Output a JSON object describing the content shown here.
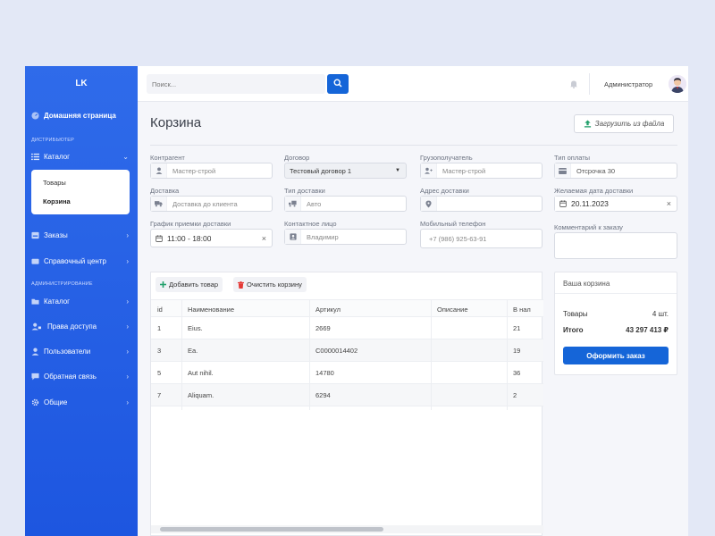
{
  "sidebar": {
    "logo": "LK",
    "home": "Домашняя страница",
    "section_distributor": "ДИСТРИБЬЮТЕР",
    "catalog": "Каталог",
    "submenu": [
      "Товары",
      "Корзина"
    ],
    "orders": "Заказы",
    "help": "Справочный центр",
    "section_admin": "АДМИНИСТРИРОВАНИЕ",
    "admin_catalog": "Каталог",
    "access": "Права доступа",
    "users": "Пользователи",
    "feedback": "Обратная связь",
    "general": "Общие"
  },
  "topbar": {
    "search_placeholder": "Поиск...",
    "user_name": "Администратор"
  },
  "page": {
    "title": "Корзина",
    "upload_label": "Загрузить из файла"
  },
  "form": {
    "counterparty_label": "Контрагент",
    "counterparty_value": "Мастер-строй",
    "contract_label": "Договор",
    "contract_value": "Тестовый договор 1",
    "consignee_label": "Грузополучатель",
    "consignee_value": "Мастер-строй",
    "payment_label": "Тип оплаты",
    "payment_value": "Отсрочка 30",
    "delivery_label": "Доставка",
    "delivery_value": "Доставка до клиента",
    "delivery_type_label": "Тип доставки",
    "delivery_type_value": "Авто",
    "address_label": "Адрес доставки",
    "address_value": "",
    "date_label": "Желаемая дата доставки",
    "date_value": "20.11.2023",
    "schedule_label": "График приемки доставки",
    "schedule_value": "11:00 - 18:00",
    "contact_label": "Контактное лицо",
    "contact_value": "Владимир",
    "phone_label": "Мобильный телефон",
    "phone_value": "+7 (986) 925-63-91",
    "comment_label": "Комментарий к заказу"
  },
  "table": {
    "add_label": "Добавить товар",
    "clear_label": "Очистить корзину",
    "columns": [
      "id",
      "Наименование",
      "Артикул",
      "Описание",
      "В нал"
    ],
    "rows": [
      {
        "id": "1",
        "name": "Eius.",
        "sku": "2669",
        "desc": "",
        "stock": "21"
      },
      {
        "id": "3",
        "name": "Ea.",
        "sku": "C0000014402",
        "desc": "",
        "stock": "19"
      },
      {
        "id": "5",
        "name": "Aut nihil.",
        "sku": "14780",
        "desc": "",
        "stock": "36"
      },
      {
        "id": "7",
        "name": "Aliquam.",
        "sku": "6294",
        "desc": "",
        "stock": "2"
      }
    ]
  },
  "cart": {
    "title": "Ваша корзина",
    "goods_label": "Товары",
    "goods_value": "4 шт.",
    "total_label": "Итого",
    "total_value": "43 297 413 ₽",
    "order_label": "Оформить заказ"
  },
  "colors": {
    "accent": "#1565d8",
    "sidebar": "#2563eb",
    "upload_icon": "#22a06b",
    "clear_icon": "#e53935",
    "add_icon": "#22a06b"
  }
}
